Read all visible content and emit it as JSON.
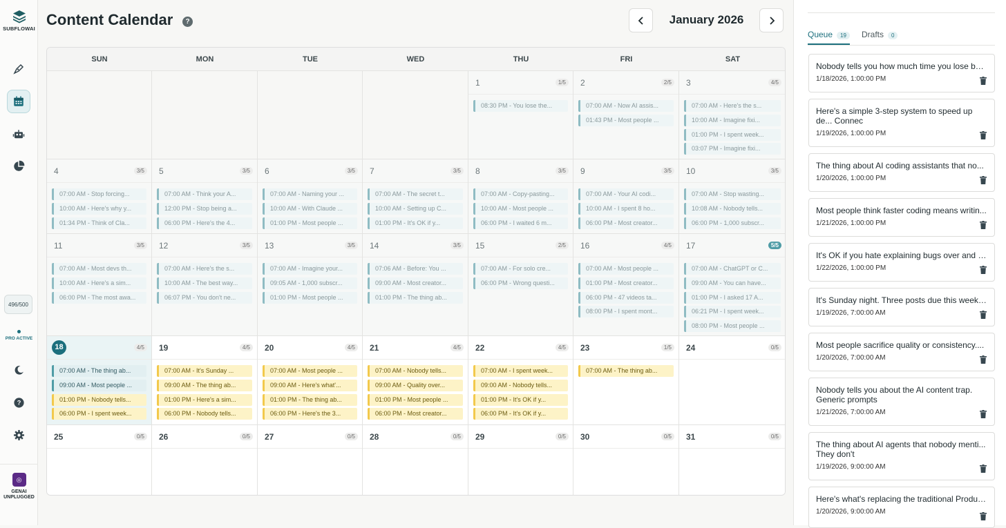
{
  "sidebar": {
    "brand": "SUBFLOWAI",
    "credits": "496/500",
    "pro_status": "PRO ACTIVE",
    "footer_brand": "GENAI UNPLUGGED"
  },
  "header": {
    "title": "Content Calendar",
    "month": "January 2026"
  },
  "calendar": {
    "weekdays": [
      "SUN",
      "MON",
      "TUE",
      "WED",
      "THU",
      "FRI",
      "SAT"
    ],
    "weeks": [
      [
        {
          "state": "empty"
        },
        {
          "state": "empty"
        },
        {
          "state": "empty"
        },
        {
          "state": "empty"
        },
        {
          "day": "1",
          "count": "1/5",
          "state": "past",
          "events": [
            {
              "t": "08:30 PM - You lose the...",
              "k": "p"
            }
          ]
        },
        {
          "day": "2",
          "count": "2/5",
          "state": "past",
          "events": [
            {
              "t": "07:00 AM - Now AI assis...",
              "k": "p"
            },
            {
              "t": "01:43 PM - Most people ...",
              "k": "p"
            }
          ]
        },
        {
          "day": "3",
          "count": "4/5",
          "state": "past",
          "events": [
            {
              "t": "07:00 AM - Here's the s...",
              "k": "p"
            },
            {
              "t": "10:00 AM - Imagine fixi...",
              "k": "p"
            },
            {
              "t": "01:00 PM - I spent week...",
              "k": "p"
            },
            {
              "t": "03:07 PM - Imagine fixi...",
              "k": "p"
            }
          ]
        }
      ],
      [
        {
          "day": "4",
          "count": "3/5",
          "state": "past",
          "events": [
            {
              "t": "07:00 AM - Stop forcing...",
              "k": "p"
            },
            {
              "t": "10:00 AM - Here's why y...",
              "k": "p"
            },
            {
              "t": "01:34 PM - Think of Cla...",
              "k": "p"
            }
          ]
        },
        {
          "day": "5",
          "count": "3/5",
          "state": "past",
          "events": [
            {
              "t": "07:00 AM - Think your A...",
              "k": "p"
            },
            {
              "t": "12:00 PM - Stop being a...",
              "k": "p"
            },
            {
              "t": "06:00 PM - Here's the 4...",
              "k": "p"
            }
          ]
        },
        {
          "day": "6",
          "count": "3/5",
          "state": "past",
          "events": [
            {
              "t": "07:00 AM - Naming your ...",
              "k": "p"
            },
            {
              "t": "10:00 AM - With Claude ...",
              "k": "p"
            },
            {
              "t": "01:00 PM - Most people ...",
              "k": "p"
            }
          ]
        },
        {
          "day": "7",
          "count": "3/5",
          "state": "past",
          "events": [
            {
              "t": "07:00 AM - The secret t...",
              "k": "p"
            },
            {
              "t": "10:00 AM - Setting up C...",
              "k": "p"
            },
            {
              "t": "01:00 PM - It's OK if y...",
              "k": "p"
            }
          ]
        },
        {
          "day": "8",
          "count": "3/5",
          "state": "past",
          "events": [
            {
              "t": "07:00 AM - Copy-pasting...",
              "k": "p"
            },
            {
              "t": "10:00 AM - Most people ...",
              "k": "p"
            },
            {
              "t": "06:00 PM - I waited 6 m...",
              "k": "p"
            }
          ]
        },
        {
          "day": "9",
          "count": "3/5",
          "state": "past",
          "events": [
            {
              "t": "07:00 AM - Your AI codi...",
              "k": "p"
            },
            {
              "t": "10:00 AM - I spent 8 ho...",
              "k": "p"
            },
            {
              "t": "06:00 PM - Most creator...",
              "k": "p"
            }
          ]
        },
        {
          "day": "10",
          "count": "3/5",
          "state": "past",
          "events": [
            {
              "t": "07:00 AM - Stop wasting...",
              "k": "p"
            },
            {
              "t": "10:08 AM - Nobody tells...",
              "k": "p"
            },
            {
              "t": "06:00 PM - 1,000 subscr...",
              "k": "p"
            }
          ]
        }
      ],
      [
        {
          "day": "11",
          "count": "3/5",
          "state": "past",
          "events": [
            {
              "t": "07:00 AM - Most devs th...",
              "k": "p"
            },
            {
              "t": "10:00 AM - Here's a sim...",
              "k": "p"
            },
            {
              "t": "06:00 PM - The most awa...",
              "k": "p"
            }
          ]
        },
        {
          "day": "12",
          "count": "3/5",
          "state": "past",
          "events": [
            {
              "t": "07:00 AM - Here's the s...",
              "k": "p"
            },
            {
              "t": "10:00 AM - The best way...",
              "k": "p"
            },
            {
              "t": "06:07 PM - You don't ne...",
              "k": "p"
            }
          ]
        },
        {
          "day": "13",
          "count": "3/5",
          "state": "past",
          "events": [
            {
              "t": "07:00 AM - Imagine your...",
              "k": "p"
            },
            {
              "t": "09:05 AM - 1,000 subscr...",
              "k": "p"
            },
            {
              "t": "01:00 PM - Most people ...",
              "k": "p"
            }
          ]
        },
        {
          "day": "14",
          "count": "3/5",
          "state": "past",
          "events": [
            {
              "t": "07:06 AM - Before: You ...",
              "k": "p"
            },
            {
              "t": "09:00 AM - Most creator...",
              "k": "p"
            },
            {
              "t": "01:00 PM - The thing ab...",
              "k": "p"
            }
          ]
        },
        {
          "day": "15",
          "count": "2/5",
          "state": "past",
          "events": [
            {
              "t": "07:00 AM - For solo cre...",
              "k": "p"
            },
            {
              "t": "06:00 PM - Wrong questi...",
              "k": "p"
            }
          ]
        },
        {
          "day": "16",
          "count": "4/5",
          "state": "past",
          "events": [
            {
              "t": "07:00 AM - Most people ...",
              "k": "p"
            },
            {
              "t": "01:00 PM - Most creator...",
              "k": "p"
            },
            {
              "t": "06:00 PM - 47 videos ta...",
              "k": "p"
            },
            {
              "t": "08:00 PM - I spent mont...",
              "k": "p"
            }
          ]
        },
        {
          "day": "17",
          "count": "5/5",
          "state": "past",
          "full": true,
          "events": [
            {
              "t": "07:00 AM - ChatGPT or C...",
              "k": "p"
            },
            {
              "t": "09:00 AM - You can have...",
              "k": "p"
            },
            {
              "t": "01:00 PM - I asked 17 A...",
              "k": "p"
            },
            {
              "t": "06:21 PM - I spent week...",
              "k": "p"
            },
            {
              "t": "08:00 PM - Most people ...",
              "k": "p"
            }
          ]
        }
      ],
      [
        {
          "day": "18",
          "count": "4/5",
          "state": "today",
          "events": [
            {
              "t": "07:00 AM - The thing ab...",
              "k": "s"
            },
            {
              "t": "09:00 AM - Most people ...",
              "k": "s"
            },
            {
              "t": "01:00 PM - Nobody tells...",
              "k": "d"
            },
            {
              "t": "06:00 PM - I spent week...",
              "k": "d"
            }
          ]
        },
        {
          "day": "19",
          "count": "4/5",
          "state": "future",
          "events": [
            {
              "t": "07:00 AM - It's Sunday ...",
              "k": "d"
            },
            {
              "t": "09:00 AM - The thing ab...",
              "k": "d"
            },
            {
              "t": "01:00 PM - Here's a sim...",
              "k": "d"
            },
            {
              "t": "06:00 PM - Nobody tells...",
              "k": "d"
            }
          ]
        },
        {
          "day": "20",
          "count": "4/5",
          "state": "future",
          "events": [
            {
              "t": "07:00 AM - Most people ...",
              "k": "d"
            },
            {
              "t": "09:00 AM - Here's what'...",
              "k": "d"
            },
            {
              "t": "01:00 PM - The thing ab...",
              "k": "d"
            },
            {
              "t": "06:00 PM - Here's the 3...",
              "k": "d"
            }
          ]
        },
        {
          "day": "21",
          "count": "4/5",
          "state": "future",
          "events": [
            {
              "t": "07:00 AM - Nobody tells...",
              "k": "d"
            },
            {
              "t": "09:00 AM - Quality over...",
              "k": "d"
            },
            {
              "t": "01:00 PM - Most people ...",
              "k": "d"
            },
            {
              "t": "06:00 PM - Most creator...",
              "k": "d"
            }
          ]
        },
        {
          "day": "22",
          "count": "4/5",
          "state": "future",
          "events": [
            {
              "t": "07:00 AM - I spent week...",
              "k": "d"
            },
            {
              "t": "09:00 AM - Nobody tells...",
              "k": "d"
            },
            {
              "t": "01:00 PM - It's OK if y...",
              "k": "d"
            },
            {
              "t": "06:00 PM - It's OK if y...",
              "k": "d"
            }
          ]
        },
        {
          "day": "23",
          "count": "1/5",
          "state": "future",
          "events": [
            {
              "t": "07:00 AM - The thing ab...",
              "k": "d"
            }
          ]
        },
        {
          "day": "24",
          "count": "0/5",
          "state": "future",
          "events": []
        }
      ],
      [
        {
          "day": "25",
          "count": "0/5",
          "state": "future",
          "events": []
        },
        {
          "day": "26",
          "count": "0/5",
          "state": "future",
          "events": []
        },
        {
          "day": "27",
          "count": "0/5",
          "state": "future",
          "events": []
        },
        {
          "day": "28",
          "count": "0/5",
          "state": "future",
          "events": []
        },
        {
          "day": "29",
          "count": "0/5",
          "state": "future",
          "events": []
        },
        {
          "day": "30",
          "count": "0/5",
          "state": "future",
          "events": []
        },
        {
          "day": "31",
          "count": "0/5",
          "state": "future",
          "events": []
        }
      ]
    ]
  },
  "panel": {
    "tabs": [
      {
        "label": "Queue",
        "count": "19"
      },
      {
        "label": "Drafts",
        "count": "0"
      }
    ],
    "queue": [
      {
        "text": "Nobody tells you how much time you lose bei...",
        "date": "1/18/2026, 1:00:00 PM"
      },
      {
        "text": "Here's a simple 3-step system to speed up de... Connec",
        "date": "1/19/2026, 1:00:00 PM",
        "wrap": true
      },
      {
        "text": "The thing about AI coding assistants that no...",
        "date": "1/20/2026, 1:00:00 PM"
      },
      {
        "text": "Most people think faster coding means writin...",
        "date": "1/21/2026, 1:00:00 PM"
      },
      {
        "text": "It's OK if you hate explaining bugs over and o...",
        "date": "1/22/2026, 1:00:00 PM"
      },
      {
        "text": "It's Sunday night. Three posts due this week....",
        "date": "1/19/2026, 7:00:00 AM"
      },
      {
        "text": "Most people sacrifice quality or consistency....",
        "date": "1/20/2026, 7:00:00 AM"
      },
      {
        "text": "Nobody tells you about the AI content trap. Generic prompts",
        "date": "1/21/2026, 7:00:00 AM",
        "wrap": true
      },
      {
        "text": "The thing about AI agents that nobody menti... They don't",
        "date": "1/19/2026, 9:00:00 AM",
        "wrap": true
      },
      {
        "text": "Here's what's replacing the traditional Produc...",
        "date": "1/20/2026, 9:00:00 AM"
      }
    ]
  }
}
